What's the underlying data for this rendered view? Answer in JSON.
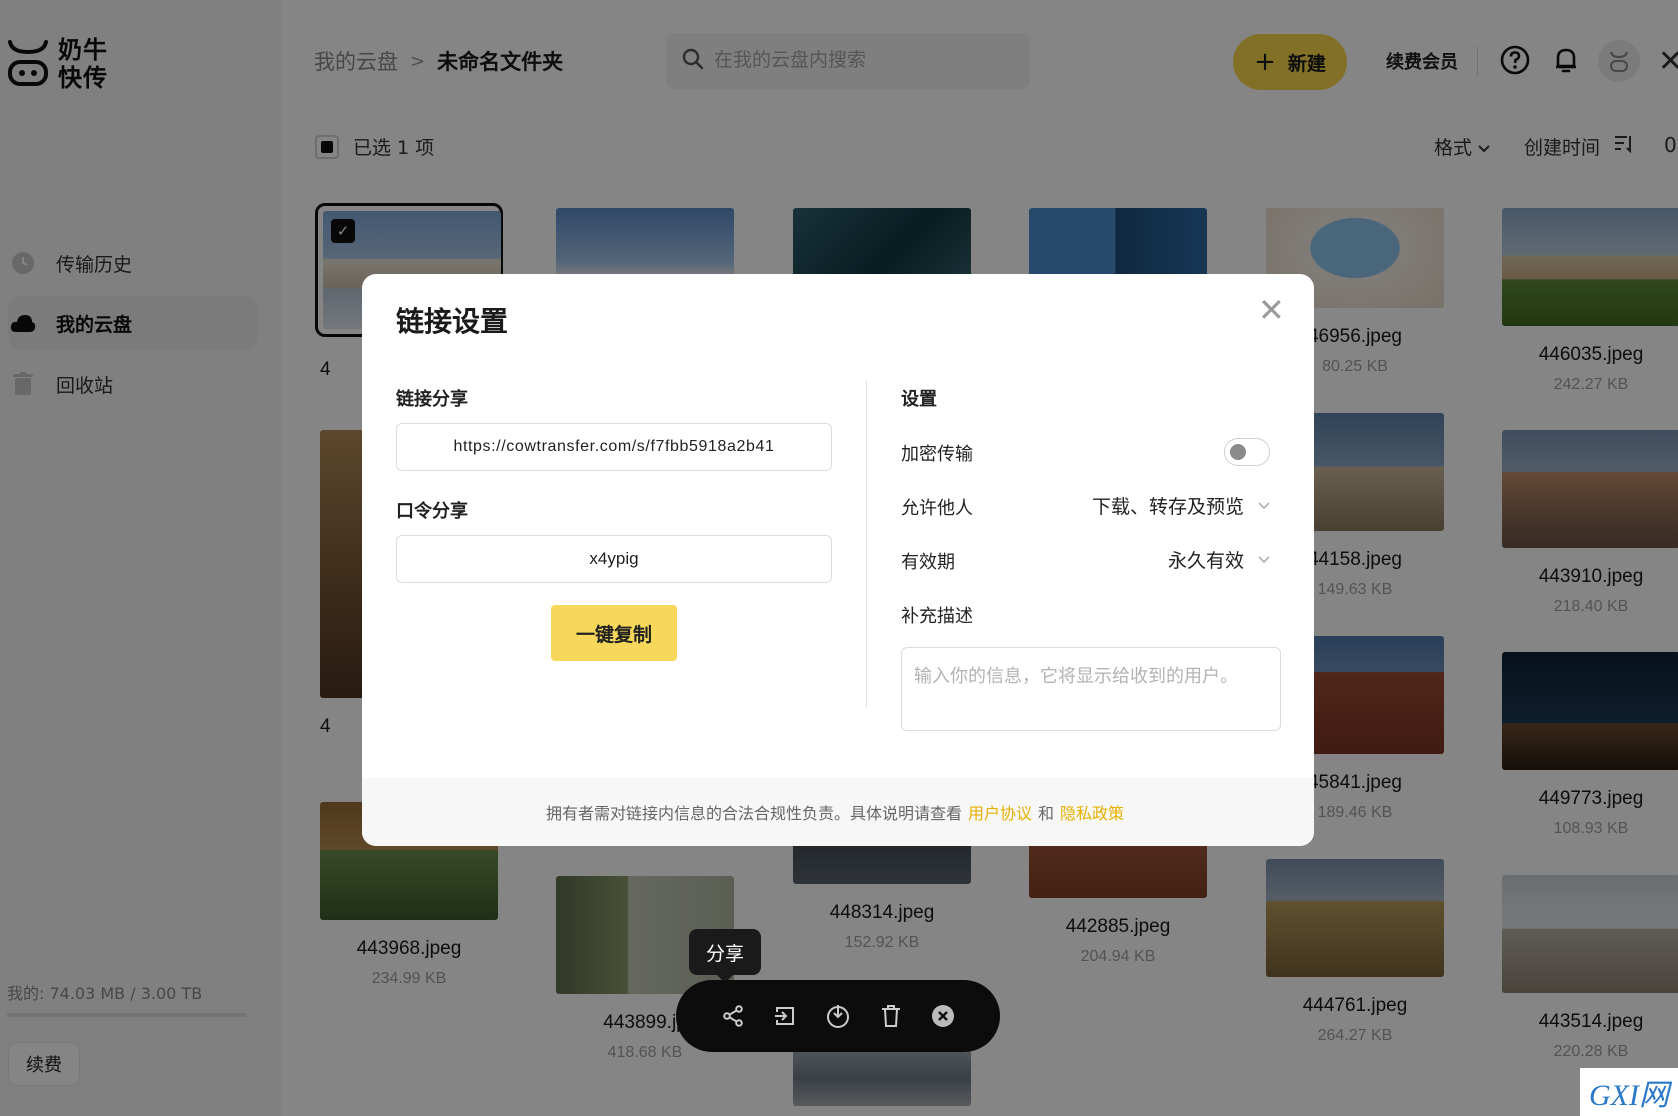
{
  "app": {
    "logo_line1": "奶牛",
    "logo_line2": "快传"
  },
  "sidebar": {
    "items": [
      {
        "label": "传输历史",
        "icon": "clock-icon"
      },
      {
        "label": "我的云盘",
        "icon": "cloud-icon"
      },
      {
        "label": "回收站",
        "icon": "trash-icon"
      }
    ],
    "storage": "我的: 74.03 MB / 3.00 TB",
    "storage_used_fraction": 2e-05,
    "renew_label": "续费"
  },
  "header": {
    "breadcrumb_root": "我的云盘",
    "breadcrumb_sep": ">",
    "breadcrumb_current": "未命名文件夹",
    "search_placeholder": "在我的云盘内搜索",
    "new_label": "新建",
    "renew_member_label": "续费会员",
    "accent_color": "#f7d64a"
  },
  "toolbar": {
    "selected_text": "已选 1 项",
    "sort_format": "格式",
    "sort_created": "创建时间",
    "view_toggle": "0"
  },
  "files": [
    {
      "name": "4",
      "size": ""
    },
    {
      "name": "",
      "size": ""
    },
    {
      "name": "",
      "size": ""
    },
    {
      "name": "",
      "size": ""
    },
    {
      "name": "46956.jpeg",
      "size": "80.25 KB"
    },
    {
      "name": "446035.jpeg",
      "size": "242.27 KB"
    },
    {
      "name": "4",
      "size": ""
    },
    {
      "name": "44158.jpeg",
      "size": "149.63 KB"
    },
    {
      "name": "443910.jpeg",
      "size": "218.40 KB"
    },
    {
      "name": "45841.jpeg",
      "size": "189.46 KB"
    },
    {
      "name": "449773.jpeg",
      "size": "108.93 KB"
    },
    {
      "name": "443968.jpeg",
      "size": "234.99 KB"
    },
    {
      "name": "443899.jp",
      "size": "418.68 KB"
    },
    {
      "name": "448314.jpeg",
      "size": "152.92 KB"
    },
    {
      "name": "442885.jpeg",
      "size": "204.94 KB"
    },
    {
      "name": "444761.jpeg",
      "size": "264.27 KB"
    },
    {
      "name": "443514.jpeg",
      "size": "220.28 KB"
    }
  ],
  "modal": {
    "title": "链接设置",
    "link_share_label": "链接分享",
    "link_url": "https://cowtransfer.com/s/f7fbb5918a2b41",
    "code_share_label": "口令分享",
    "code_value": "x4ypig",
    "copy_button": "一键复制",
    "settings_label": "设置",
    "encrypt_label": "加密传输",
    "encrypt_on": false,
    "allow_label": "允许他人",
    "allow_value": "下载、转存及预览",
    "validity_label": "有效期",
    "validity_value": "永久有效",
    "desc_label": "补充描述",
    "desc_placeholder": "输入你的信息，它将显示给收到的用户。",
    "footer_text": "拥有者需对链接内信息的合法合规性负责。具体说明请查看",
    "footer_link1": "用户协议",
    "footer_and": "和",
    "footer_link2": "隐私政策"
  },
  "action_bar": {
    "tooltip": "分享",
    "icons": [
      "share-icon",
      "move-icon",
      "download-icon",
      "delete-icon",
      "close-circle-icon"
    ]
  },
  "watermark": "GXI网"
}
